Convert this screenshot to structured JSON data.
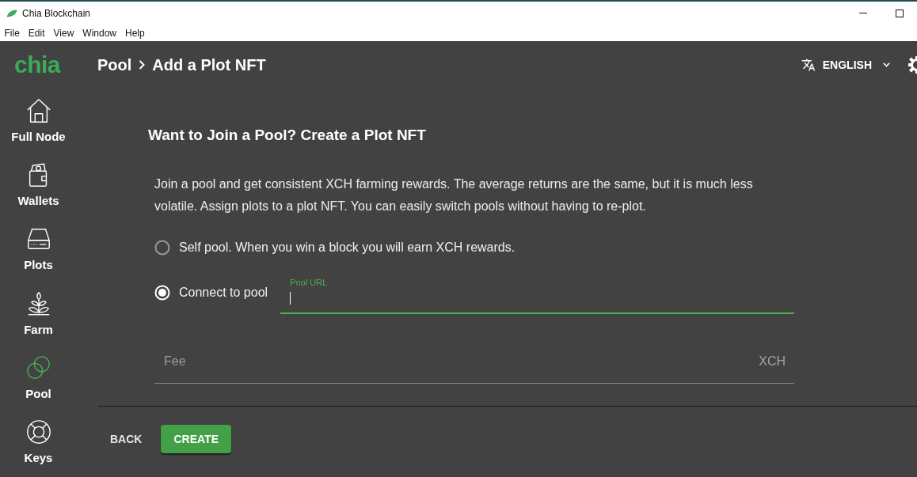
{
  "window": {
    "title": "Chia Blockchain"
  },
  "menu_bar": [
    "File",
    "Edit",
    "View",
    "Window",
    "Help"
  ],
  "app_bar": {
    "logo": "chia",
    "breadcrumb": [
      "Pool",
      "Add a Plot NFT"
    ],
    "language": "ENGLISH"
  },
  "sidebar": {
    "items": [
      {
        "label": "Full Node",
        "selected": false
      },
      {
        "label": "Wallets",
        "selected": false
      },
      {
        "label": "Plots",
        "selected": false
      },
      {
        "label": "Farm",
        "selected": false
      },
      {
        "label": "Pool",
        "selected": true
      },
      {
        "label": "Keys",
        "selected": false
      }
    ]
  },
  "form": {
    "title": "Want to Join a Pool? Create a Plot NFT",
    "description": "Join a pool and get consistent XCH farming rewards. The average returns are the same, but it is much less volatile. Assign plots to a plot NFT. You can easily switch pools without having to re-plot.",
    "options": [
      {
        "label": "Self pool. When you win a block you will earn XCH rewards.",
        "selected": false
      },
      {
        "label": "Connect to pool",
        "selected": true,
        "field": {
          "label": "Pool URL",
          "focused": true
        }
      }
    ],
    "fee_field": {
      "label": "Fee",
      "unit": "XCH",
      "focused": false
    }
  },
  "actions": [
    {
      "label": "BACK",
      "kind": "text"
    },
    {
      "label": "CREATE",
      "kind": "contained"
    }
  ]
}
